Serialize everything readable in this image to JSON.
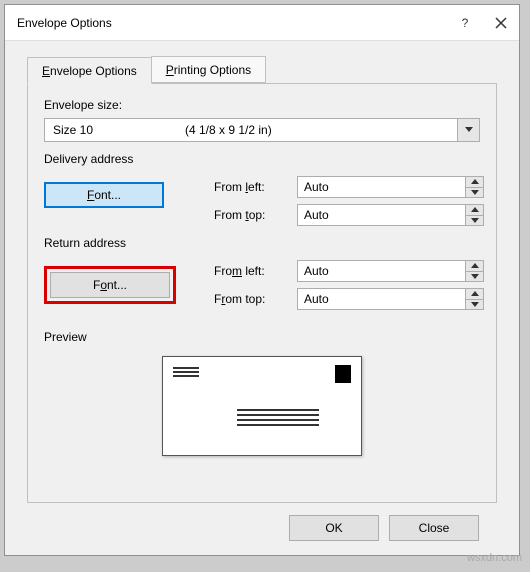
{
  "window": {
    "title": "Envelope Options"
  },
  "tabs": {
    "envelope": "Envelope Options",
    "printing": "Printing Options"
  },
  "size": {
    "label": "Envelope size:",
    "selected": "Size 10",
    "detail": "(4 1/8 x 9 1/2 in)"
  },
  "delivery": {
    "section": "Delivery address",
    "font_button": "Font...",
    "from_left_label": "From left:",
    "from_left_value": "Auto",
    "from_top_label": "From top:",
    "from_top_value": "Auto"
  },
  "return": {
    "section": "Return address",
    "font_button": "Font...",
    "from_left_label": "From left:",
    "from_left_value": "Auto",
    "from_top_label": "From top:",
    "from_top_value": "Auto"
  },
  "preview": {
    "label": "Preview"
  },
  "buttons": {
    "ok": "OK",
    "close": "Close"
  },
  "watermark": "wsxdn.com"
}
